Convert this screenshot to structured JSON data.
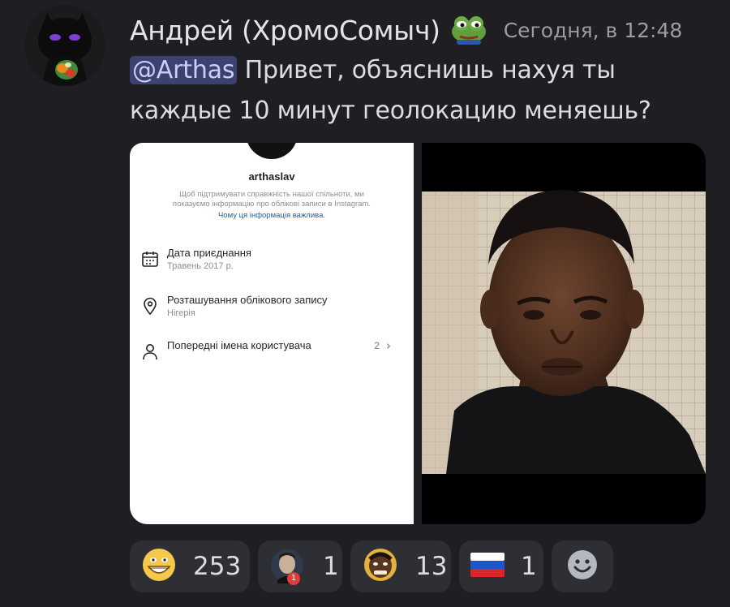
{
  "message": {
    "author": "Андрей (ХромоСомыч)",
    "timestamp": "Сегодня, в 12:48",
    "mention": "@Arthas",
    "text": " Привет, объяснишь нахуя ты каждые 10 минут геолокацию меняешь?"
  },
  "attachment_profile": {
    "username": "arthaslav",
    "description": "Щоб підтримувати справжність нашої спільноти, ми показуємо інформацію про облікові записи в Instagram.",
    "link": "Чому ця інформація важлива.",
    "rows": [
      {
        "title": "Дата приєднання",
        "subtitle": "Травень 2017 р.",
        "icon": "calendar-icon"
      },
      {
        "title": "Розташування облікового запису",
        "subtitle": "Нігерія",
        "icon": "location-pin-icon"
      },
      {
        "title": "Попередні імена користувача",
        "count": "2",
        "icon": "person-icon"
      }
    ]
  },
  "reactions": [
    {
      "emoji": "grinning-face-emoji",
      "count": "253"
    },
    {
      "emoji": "custom-character-emoji",
      "count": "1",
      "badge": "1"
    },
    {
      "emoji": "custom-face-emoji",
      "count": "13"
    },
    {
      "emoji": "russian-flag-emoji",
      "count": "1"
    }
  ],
  "add_reaction": "add-reaction-smiley-icon",
  "colors": {
    "background": "#1f1f23",
    "mention_bg": "#3c4270",
    "reaction_bg": "#2e2f34"
  }
}
